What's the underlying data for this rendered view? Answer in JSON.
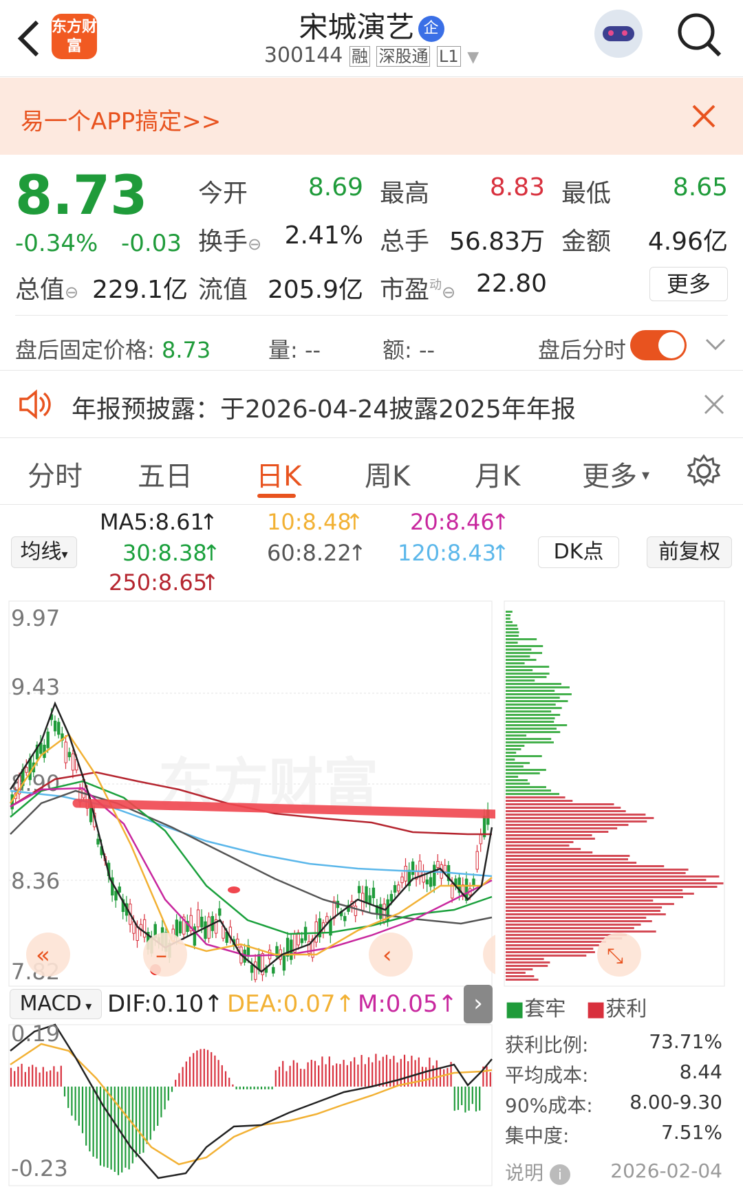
{
  "header": {
    "title": "宋城演艺",
    "code": "300144",
    "tags": [
      "融",
      "深股通",
      "L1"
    ],
    "badge": "企",
    "logo": "东方财富"
  },
  "banner": {
    "text": "易一个APP搞定>>"
  },
  "quote": {
    "price": "8.73",
    "change_pct": "-0.34%",
    "change": "-0.03",
    "fields": [
      {
        "label": "今开",
        "value": "8.69",
        "color": "green"
      },
      {
        "label": "最高",
        "value": "8.83",
        "color": "red"
      },
      {
        "label": "最低",
        "value": "8.65",
        "color": "green"
      },
      {
        "label": "换手",
        "value": "2.41%",
        "color": "dark"
      },
      {
        "label": "总手",
        "value": "56.83万",
        "color": "dark"
      },
      {
        "label": "金额",
        "value": "4.96亿",
        "color": "dark"
      },
      {
        "label": "总值",
        "value": "229.1亿",
        "color": "dark"
      },
      {
        "label": "流值",
        "value": "205.9亿",
        "color": "dark"
      },
      {
        "label": "市盈",
        "value": "22.80",
        "color": "dark",
        "sup": "动"
      }
    ],
    "more": "更多"
  },
  "afterhours": {
    "price_label": "盘后固定价格: ",
    "price": "8.73",
    "vol": "量: --",
    "amt": "额: --",
    "toggle_label": "盘后分时"
  },
  "notice": {
    "text": "年报预披露：于2026-04-24披露2025年年报"
  },
  "tabs": [
    "分时",
    "五日",
    "日K",
    "周K",
    "月K",
    "更多"
  ],
  "ma": {
    "selector": "均线",
    "ma5": "MA5:8.61",
    "ma10": "10:8.48",
    "ma20": "20:8.46",
    "ma30": "30:8.38",
    "ma60": "60:8.22",
    "ma120": "120:8.43",
    "ma250": "250:8.65",
    "dk": "DK点",
    "fuquan": "前复权"
  },
  "kchart": {
    "ticks": [
      "9.97",
      "9.43",
      "8.90",
      "8.36",
      "7.82"
    ],
    "watermark": "东方财富"
  },
  "macd": {
    "selector": "MACD",
    "dif": "DIF:0.10",
    "dea": "DEA:0.07",
    "m": "M:0.05",
    "ticks": [
      "0.19",
      "-0.23"
    ]
  },
  "chips": {
    "legend_trapped": "套牢",
    "legend_profit": "获利",
    "stats": [
      {
        "label": "获利比例:",
        "value": "73.71%"
      },
      {
        "label": "平均成本:",
        "value": "8.44"
      },
      {
        "label": "90%成本:",
        "value": "8.00-9.30"
      },
      {
        "label": "集中度:",
        "value": "7.51%"
      }
    ],
    "explain": "说明",
    "date": "2026-02-04"
  },
  "colors": {
    "up": "#d8303d",
    "down": "#1f9b3a",
    "accent": "#e8531f",
    "ma5": "#222222",
    "ma10": "#f2b134",
    "ma20": "#c8279e",
    "ma30": "#1aa03c",
    "ma60": "#555555",
    "ma120": "#5bb7ea",
    "ma250": "#b5252f"
  }
}
